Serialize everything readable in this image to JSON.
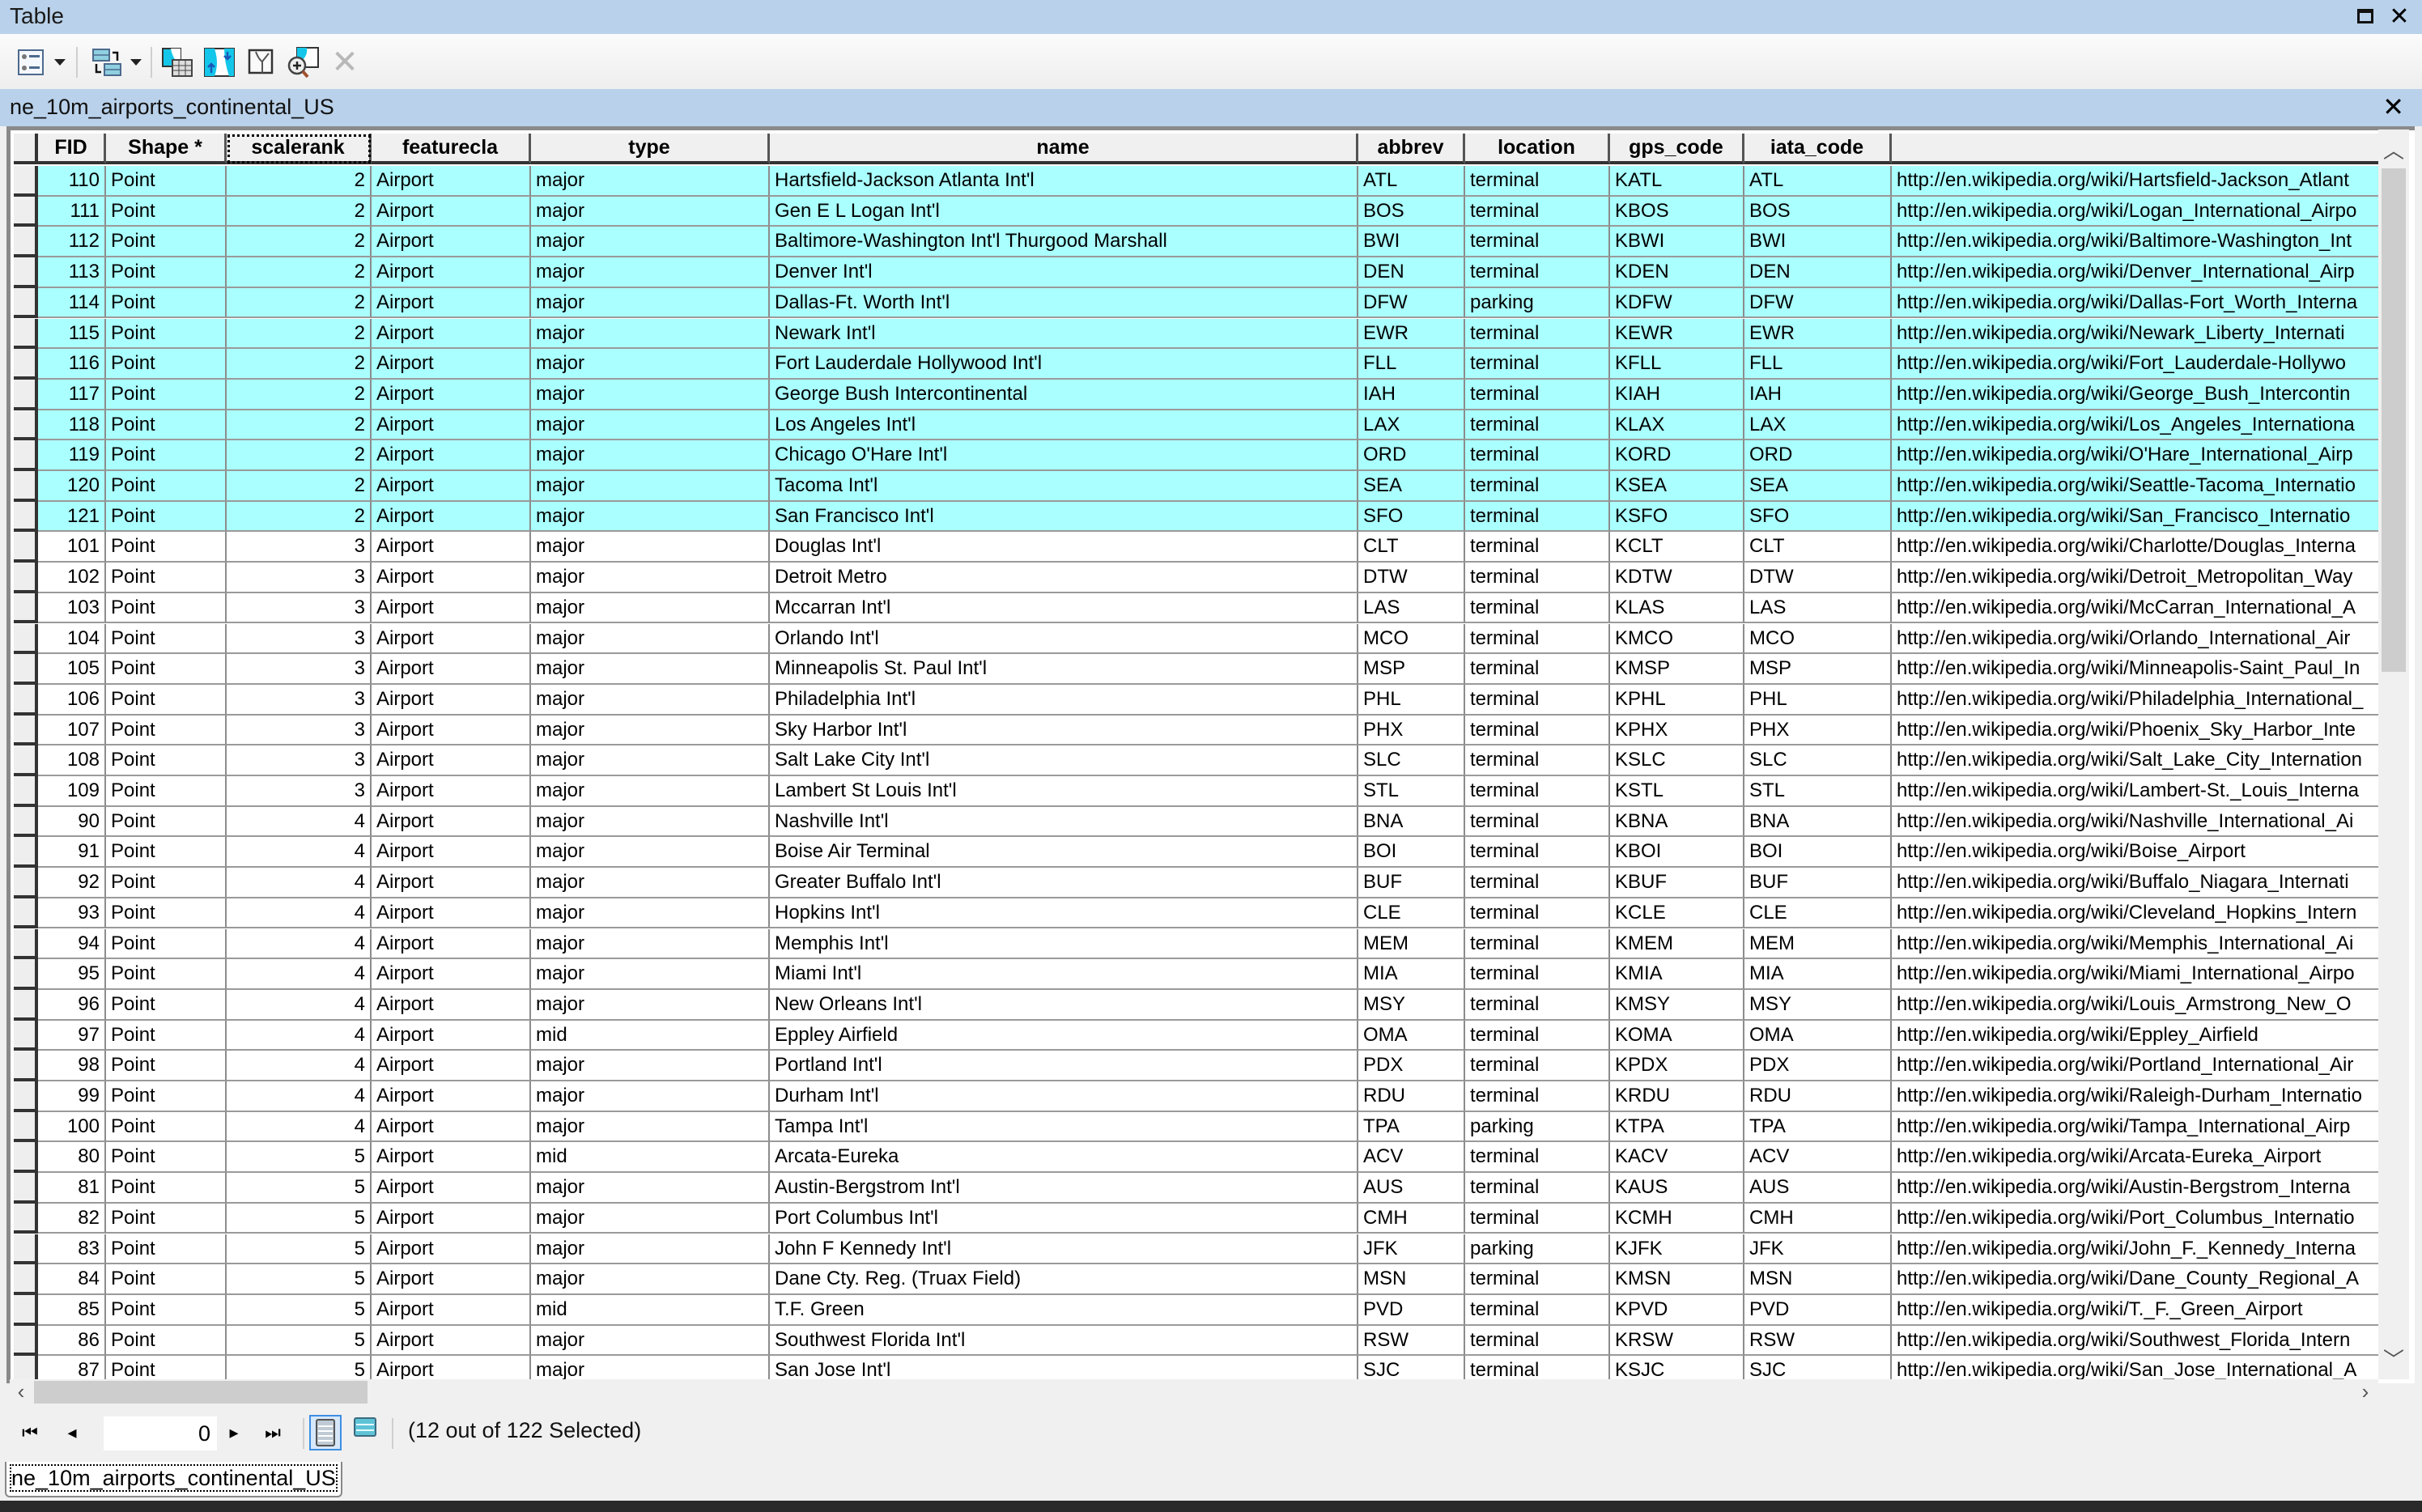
{
  "window": {
    "title": "Table",
    "restore_icon": "restore-icon",
    "close_icon": "close-icon"
  },
  "toolbar": {
    "buttons": [
      {
        "name": "table-options",
        "icon": "table-options-icon",
        "has_dropdown": true
      },
      {
        "name": "related-tables",
        "icon": "related-tables-icon",
        "has_dropdown": true
      },
      {
        "name": "select-by-attributes",
        "icon": "select-by-attributes-icon"
      },
      {
        "name": "switch-selection",
        "icon": "switch-selection-icon"
      },
      {
        "name": "clear-selection",
        "icon": "clear-selection-icon"
      },
      {
        "name": "zoom-to-selected",
        "icon": "zoom-to-selected-icon"
      },
      {
        "name": "delete-selected",
        "icon": "delete-icon",
        "disabled": true
      }
    ]
  },
  "table": {
    "name": "ne_10m_airports_continental_US",
    "active_column": "scalerank",
    "columns": [
      "FID",
      "Shape *",
      "scalerank",
      "featurecla",
      "type",
      "name",
      "abbrev",
      "location",
      "gps_code",
      "iata_code",
      ""
    ],
    "rows": [
      {
        "selected": true,
        "cells": [
          "110",
          "Point",
          "2",
          "Airport",
          "major",
          "Hartsfield-Jackson Atlanta Int'l",
          "ATL",
          "terminal",
          "KATL",
          "ATL",
          "http://en.wikipedia.org/wiki/Hartsfield-Jackson_Atlant"
        ]
      },
      {
        "selected": true,
        "cells": [
          "111",
          "Point",
          "2",
          "Airport",
          "major",
          "Gen E L Logan Int'l",
          "BOS",
          "terminal",
          "KBOS",
          "BOS",
          "http://en.wikipedia.org/wiki/Logan_International_Airpo"
        ]
      },
      {
        "selected": true,
        "cells": [
          "112",
          "Point",
          "2",
          "Airport",
          "major",
          "Baltimore-Washington Int'l Thurgood Marshall",
          "BWI",
          "terminal",
          "KBWI",
          "BWI",
          "http://en.wikipedia.org/wiki/Baltimore-Washington_Int"
        ]
      },
      {
        "selected": true,
        "cells": [
          "113",
          "Point",
          "2",
          "Airport",
          "major",
          "Denver Int'l",
          "DEN",
          "terminal",
          "KDEN",
          "DEN",
          "http://en.wikipedia.org/wiki/Denver_International_Airp"
        ]
      },
      {
        "selected": true,
        "cells": [
          "114",
          "Point",
          "2",
          "Airport",
          "major",
          "Dallas-Ft. Worth Int'l",
          "DFW",
          "parking",
          "KDFW",
          "DFW",
          "http://en.wikipedia.org/wiki/Dallas-Fort_Worth_Interna"
        ]
      },
      {
        "selected": true,
        "cells": [
          "115",
          "Point",
          "2",
          "Airport",
          "major",
          "Newark Int'l",
          "EWR",
          "terminal",
          "KEWR",
          "EWR",
          "http://en.wikipedia.org/wiki/Newark_Liberty_Internati"
        ]
      },
      {
        "selected": true,
        "cells": [
          "116",
          "Point",
          "2",
          "Airport",
          "major",
          "Fort Lauderdale Hollywood Int'l",
          "FLL",
          "terminal",
          "KFLL",
          "FLL",
          "http://en.wikipedia.org/wiki/Fort_Lauderdale-Hollywo"
        ]
      },
      {
        "selected": true,
        "cells": [
          "117",
          "Point",
          "2",
          "Airport",
          "major",
          "George Bush Intercontinental",
          "IAH",
          "terminal",
          "KIAH",
          "IAH",
          "http://en.wikipedia.org/wiki/George_Bush_Intercontin"
        ]
      },
      {
        "selected": true,
        "cells": [
          "118",
          "Point",
          "2",
          "Airport",
          "major",
          "Los Angeles Int'l",
          "LAX",
          "terminal",
          "KLAX",
          "LAX",
          "http://en.wikipedia.org/wiki/Los_Angeles_Internationa"
        ]
      },
      {
        "selected": true,
        "cells": [
          "119",
          "Point",
          "2",
          "Airport",
          "major",
          "Chicago O'Hare Int'l",
          "ORD",
          "terminal",
          "KORD",
          "ORD",
          "http://en.wikipedia.org/wiki/O'Hare_International_Airp"
        ]
      },
      {
        "selected": true,
        "cells": [
          "120",
          "Point",
          "2",
          "Airport",
          "major",
          "Tacoma Int'l",
          "SEA",
          "terminal",
          "KSEA",
          "SEA",
          "http://en.wikipedia.org/wiki/Seattle-Tacoma_Internatio"
        ]
      },
      {
        "selected": true,
        "cells": [
          "121",
          "Point",
          "2",
          "Airport",
          "major",
          "San Francisco Int'l",
          "SFO",
          "terminal",
          "KSFO",
          "SFO",
          "http://en.wikipedia.org/wiki/San_Francisco_Internatio"
        ]
      },
      {
        "selected": false,
        "cells": [
          "101",
          "Point",
          "3",
          "Airport",
          "major",
          "Douglas Int'l",
          "CLT",
          "terminal",
          "KCLT",
          "CLT",
          "http://en.wikipedia.org/wiki/Charlotte/Douglas_Interna"
        ]
      },
      {
        "selected": false,
        "cells": [
          "102",
          "Point",
          "3",
          "Airport",
          "major",
          "Detroit Metro",
          "DTW",
          "terminal",
          "KDTW",
          "DTW",
          "http://en.wikipedia.org/wiki/Detroit_Metropolitan_Way"
        ]
      },
      {
        "selected": false,
        "cells": [
          "103",
          "Point",
          "3",
          "Airport",
          "major",
          "Mccarran Int'l",
          "LAS",
          "terminal",
          "KLAS",
          "LAS",
          "http://en.wikipedia.org/wiki/McCarran_International_A"
        ]
      },
      {
        "selected": false,
        "cells": [
          "104",
          "Point",
          "3",
          "Airport",
          "major",
          "Orlando Int'l",
          "MCO",
          "terminal",
          "KMCO",
          "MCO",
          "http://en.wikipedia.org/wiki/Orlando_International_Air"
        ]
      },
      {
        "selected": false,
        "cells": [
          "105",
          "Point",
          "3",
          "Airport",
          "major",
          "Minneapolis St. Paul Int'l",
          "MSP",
          "terminal",
          "KMSP",
          "MSP",
          "http://en.wikipedia.org/wiki/Minneapolis-Saint_Paul_In"
        ]
      },
      {
        "selected": false,
        "cells": [
          "106",
          "Point",
          "3",
          "Airport",
          "major",
          "Philadelphia Int'l",
          "PHL",
          "terminal",
          "KPHL",
          "PHL",
          "http://en.wikipedia.org/wiki/Philadelphia_International_"
        ]
      },
      {
        "selected": false,
        "cells": [
          "107",
          "Point",
          "3",
          "Airport",
          "major",
          "Sky Harbor Int'l",
          "PHX",
          "terminal",
          "KPHX",
          "PHX",
          "http://en.wikipedia.org/wiki/Phoenix_Sky_Harbor_Inte"
        ]
      },
      {
        "selected": false,
        "cells": [
          "108",
          "Point",
          "3",
          "Airport",
          "major",
          "Salt Lake City Int'l",
          "SLC",
          "terminal",
          "KSLC",
          "SLC",
          "http://en.wikipedia.org/wiki/Salt_Lake_City_Internation"
        ]
      },
      {
        "selected": false,
        "cells": [
          "109",
          "Point",
          "3",
          "Airport",
          "major",
          "Lambert St Louis Int'l",
          "STL",
          "terminal",
          "KSTL",
          "STL",
          "http://en.wikipedia.org/wiki/Lambert-St._Louis_Interna"
        ]
      },
      {
        "selected": false,
        "cells": [
          "90",
          "Point",
          "4",
          "Airport",
          "major",
          "Nashville Int'l",
          "BNA",
          "terminal",
          "KBNA",
          "BNA",
          "http://en.wikipedia.org/wiki/Nashville_International_Ai"
        ]
      },
      {
        "selected": false,
        "cells": [
          "91",
          "Point",
          "4",
          "Airport",
          "major",
          "Boise Air Terminal",
          "BOI",
          "terminal",
          "KBOI",
          "BOI",
          "http://en.wikipedia.org/wiki/Boise_Airport"
        ]
      },
      {
        "selected": false,
        "cells": [
          "92",
          "Point",
          "4",
          "Airport",
          "major",
          "Greater Buffalo Int'l",
          "BUF",
          "terminal",
          "KBUF",
          "BUF",
          "http://en.wikipedia.org/wiki/Buffalo_Niagara_Internati"
        ]
      },
      {
        "selected": false,
        "cells": [
          "93",
          "Point",
          "4",
          "Airport",
          "major",
          "Hopkins Int'l",
          "CLE",
          "terminal",
          "KCLE",
          "CLE",
          "http://en.wikipedia.org/wiki/Cleveland_Hopkins_Intern"
        ]
      },
      {
        "selected": false,
        "cells": [
          "94",
          "Point",
          "4",
          "Airport",
          "major",
          "Memphis Int'l",
          "MEM",
          "terminal",
          "KMEM",
          "MEM",
          "http://en.wikipedia.org/wiki/Memphis_International_Ai"
        ]
      },
      {
        "selected": false,
        "cells": [
          "95",
          "Point",
          "4",
          "Airport",
          "major",
          "Miami Int'l",
          "MIA",
          "terminal",
          "KMIA",
          "MIA",
          "http://en.wikipedia.org/wiki/Miami_International_Airpo"
        ]
      },
      {
        "selected": false,
        "cells": [
          "96",
          "Point",
          "4",
          "Airport",
          "major",
          "New Orleans Int'l",
          "MSY",
          "terminal",
          "KMSY",
          "MSY",
          "http://en.wikipedia.org/wiki/Louis_Armstrong_New_O"
        ]
      },
      {
        "selected": false,
        "cells": [
          "97",
          "Point",
          "4",
          "Airport",
          "mid",
          "Eppley Airfield",
          "OMA",
          "terminal",
          "KOMA",
          "OMA",
          "http://en.wikipedia.org/wiki/Eppley_Airfield"
        ]
      },
      {
        "selected": false,
        "cells": [
          "98",
          "Point",
          "4",
          "Airport",
          "major",
          "Portland Int'l",
          "PDX",
          "terminal",
          "KPDX",
          "PDX",
          "http://en.wikipedia.org/wiki/Portland_International_Air"
        ]
      },
      {
        "selected": false,
        "cells": [
          "99",
          "Point",
          "4",
          "Airport",
          "major",
          "Durham Int'l",
          "RDU",
          "terminal",
          "KRDU",
          "RDU",
          "http://en.wikipedia.org/wiki/Raleigh-Durham_Internatio"
        ]
      },
      {
        "selected": false,
        "cells": [
          "100",
          "Point",
          "4",
          "Airport",
          "major",
          "Tampa Int'l",
          "TPA",
          "parking",
          "KTPA",
          "TPA",
          "http://en.wikipedia.org/wiki/Tampa_International_Airp"
        ]
      },
      {
        "selected": false,
        "cells": [
          "80",
          "Point",
          "5",
          "Airport",
          "mid",
          "Arcata-Eureka",
          "ACV",
          "terminal",
          "KACV",
          "ACV",
          "http://en.wikipedia.org/wiki/Arcata-Eureka_Airport"
        ]
      },
      {
        "selected": false,
        "cells": [
          "81",
          "Point",
          "5",
          "Airport",
          "major",
          "Austin-Bergstrom Int'l",
          "AUS",
          "terminal",
          "KAUS",
          "AUS",
          "http://en.wikipedia.org/wiki/Austin-Bergstrom_Interna"
        ]
      },
      {
        "selected": false,
        "cells": [
          "82",
          "Point",
          "5",
          "Airport",
          "major",
          "Port Columbus Int'l",
          "CMH",
          "terminal",
          "KCMH",
          "CMH",
          "http://en.wikipedia.org/wiki/Port_Columbus_Internatio"
        ]
      },
      {
        "selected": false,
        "cells": [
          "83",
          "Point",
          "5",
          "Airport",
          "major",
          "John F Kennedy Int'l",
          "JFK",
          "parking",
          "KJFK",
          "JFK",
          "http://en.wikipedia.org/wiki/John_F._Kennedy_Interna"
        ]
      },
      {
        "selected": false,
        "cells": [
          "84",
          "Point",
          "5",
          "Airport",
          "major",
          "Dane Cty. Reg. (Truax Field)",
          "MSN",
          "terminal",
          "KMSN",
          "MSN",
          "http://en.wikipedia.org/wiki/Dane_County_Regional_A"
        ]
      },
      {
        "selected": false,
        "cells": [
          "85",
          "Point",
          "5",
          "Airport",
          "mid",
          "T.F. Green",
          "PVD",
          "terminal",
          "KPVD",
          "PVD",
          "http://en.wikipedia.org/wiki/T._F._Green_Airport"
        ]
      },
      {
        "selected": false,
        "cells": [
          "86",
          "Point",
          "5",
          "Airport",
          "major",
          "Southwest Florida Int'l",
          "RSW",
          "terminal",
          "KRSW",
          "RSW",
          "http://en.wikipedia.org/wiki/Southwest_Florida_Intern"
        ]
      },
      {
        "selected": false,
        "cells": [
          "87",
          "Point",
          "5",
          "Airport",
          "major",
          "San Jose Int'l",
          "SJC",
          "terminal",
          "KSJC",
          "SJC",
          "http://en.wikipedia.org/wiki/San_Jose_International_A"
        ]
      }
    ]
  },
  "footer": {
    "first_record_icon": "first-record-icon",
    "prev_record_icon": "previous-record-icon",
    "current_record": "0",
    "next_record_icon": "next-record-icon",
    "last_record_icon": "last-record-icon",
    "show_all_icon": "show-all-records-icon",
    "show_selected_icon": "show-selected-records-icon",
    "status": "(12 out of 122 Selected)"
  },
  "tabs": [
    {
      "label": "ne_10m_airports_continental_US",
      "active": true
    }
  ],
  "colors": {
    "selection": "#aaffff",
    "titlebar": "#b9d1ea"
  }
}
